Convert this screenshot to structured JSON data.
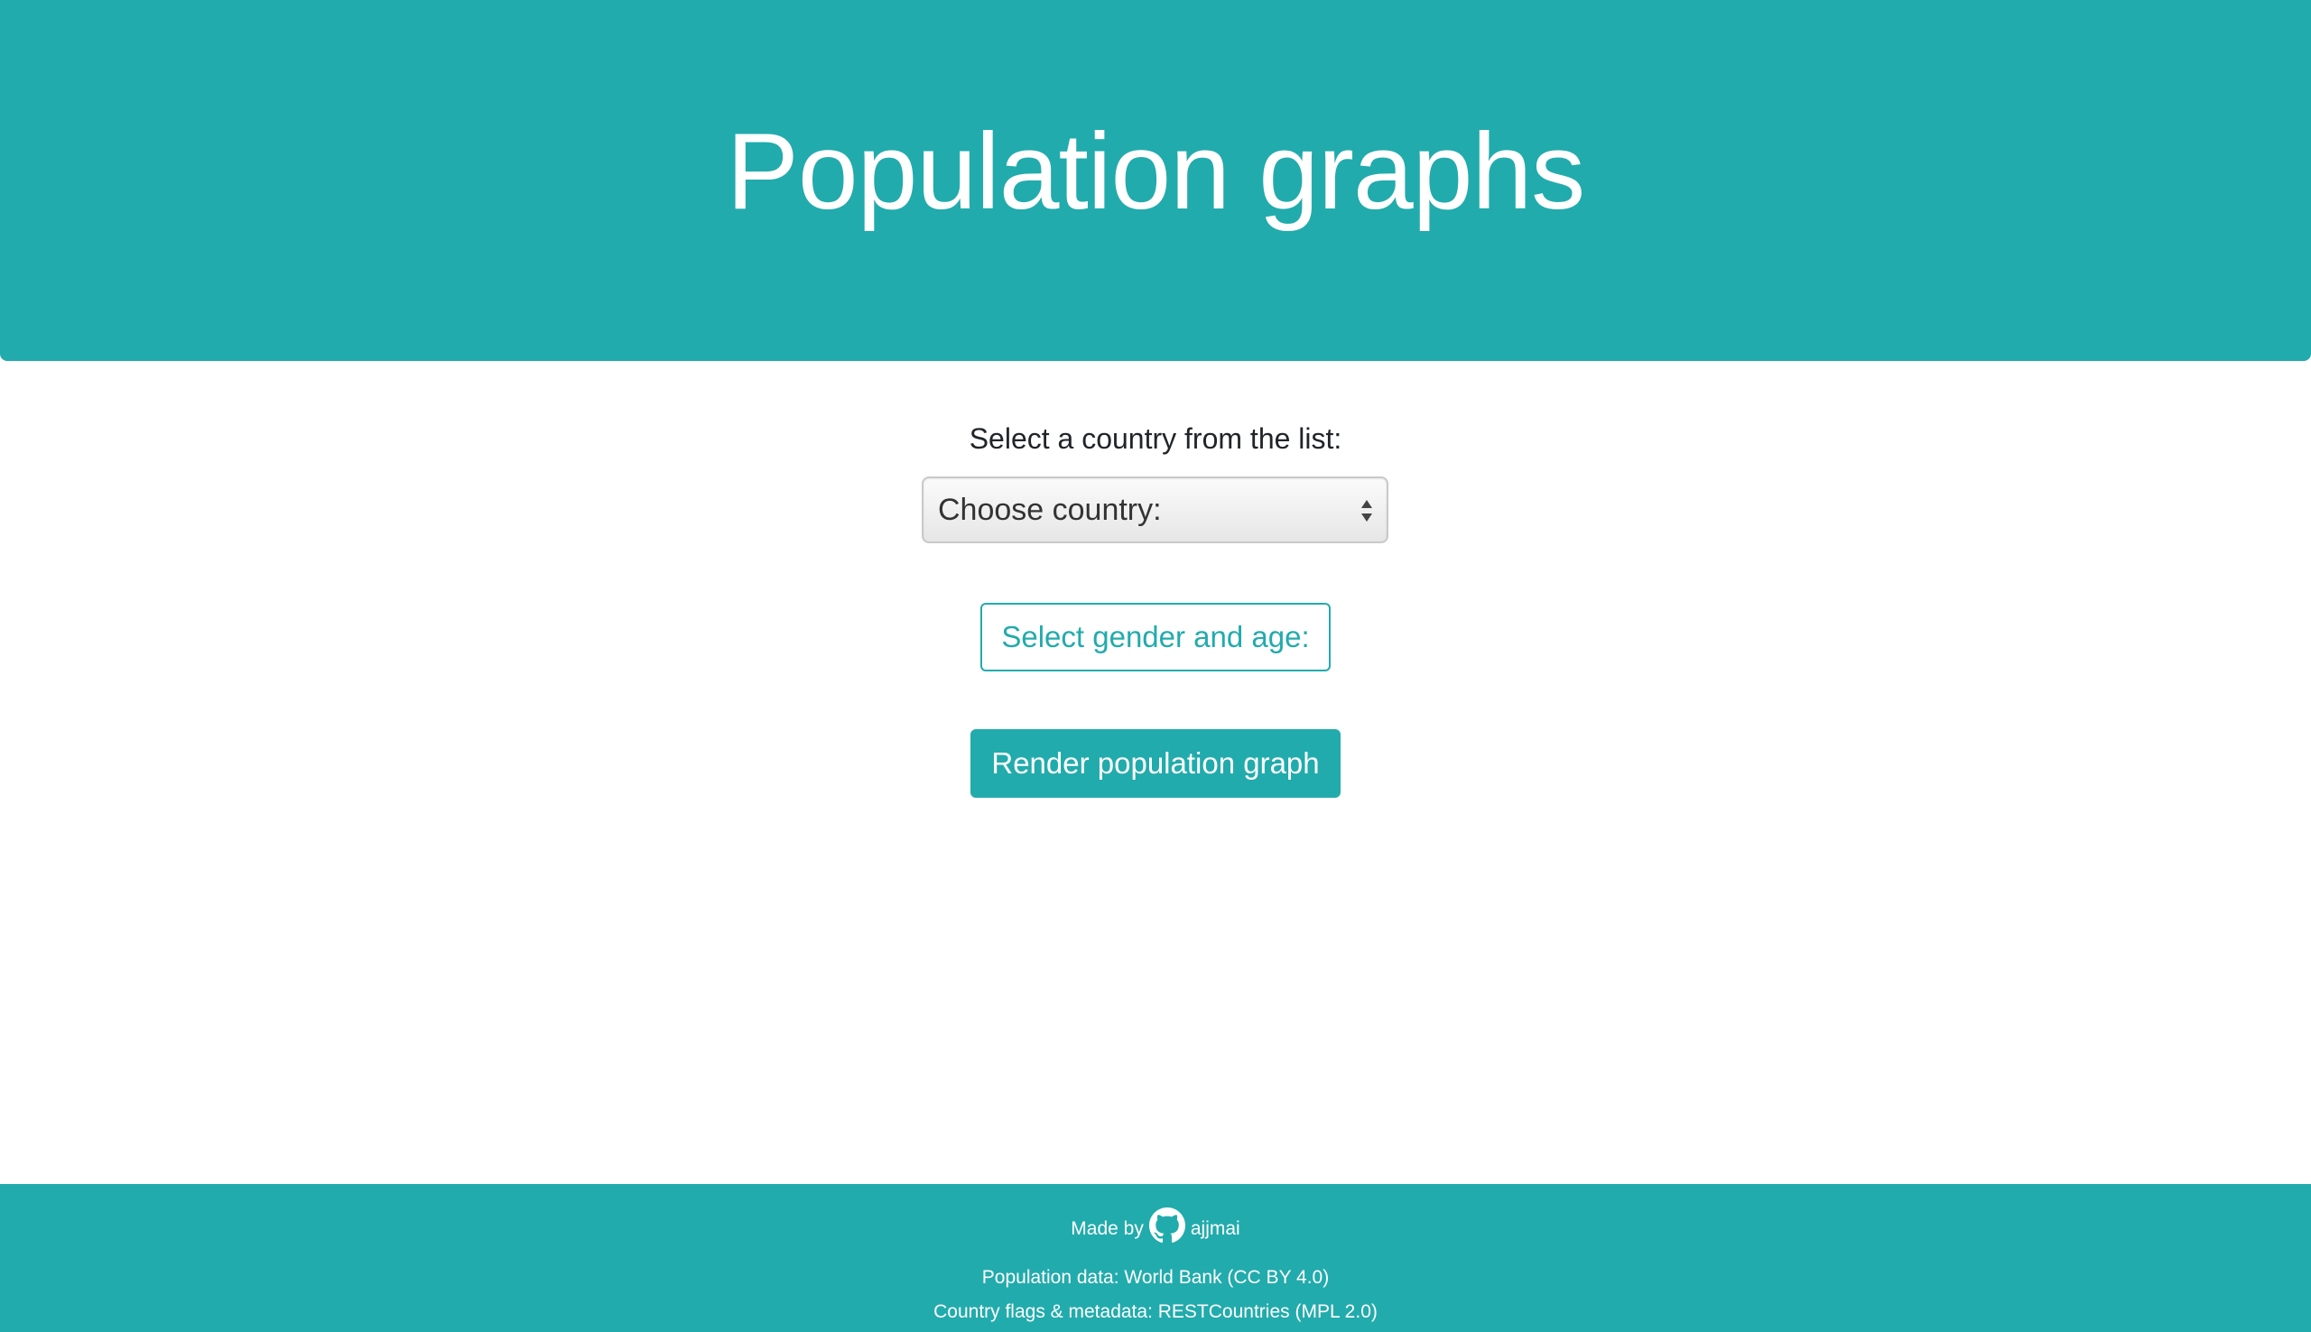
{
  "header": {
    "title": "Population graphs"
  },
  "form": {
    "country_label": "Select a country from the list:",
    "country_select_value": "Choose country:",
    "gender_age_button": "Select gender and age:",
    "render_button": "Render population graph"
  },
  "footer": {
    "made_by": "Made by",
    "author": "ajjmai",
    "author_icon": "github-icon",
    "population_data": "Population data: World Bank (CC BY 4.0)",
    "flags_metadata": "Country flags & metadata: RESTCountries (MPL 2.0)"
  },
  "colors": {
    "accent": "#22abac",
    "text": "#212529",
    "background": "#ffffff"
  }
}
